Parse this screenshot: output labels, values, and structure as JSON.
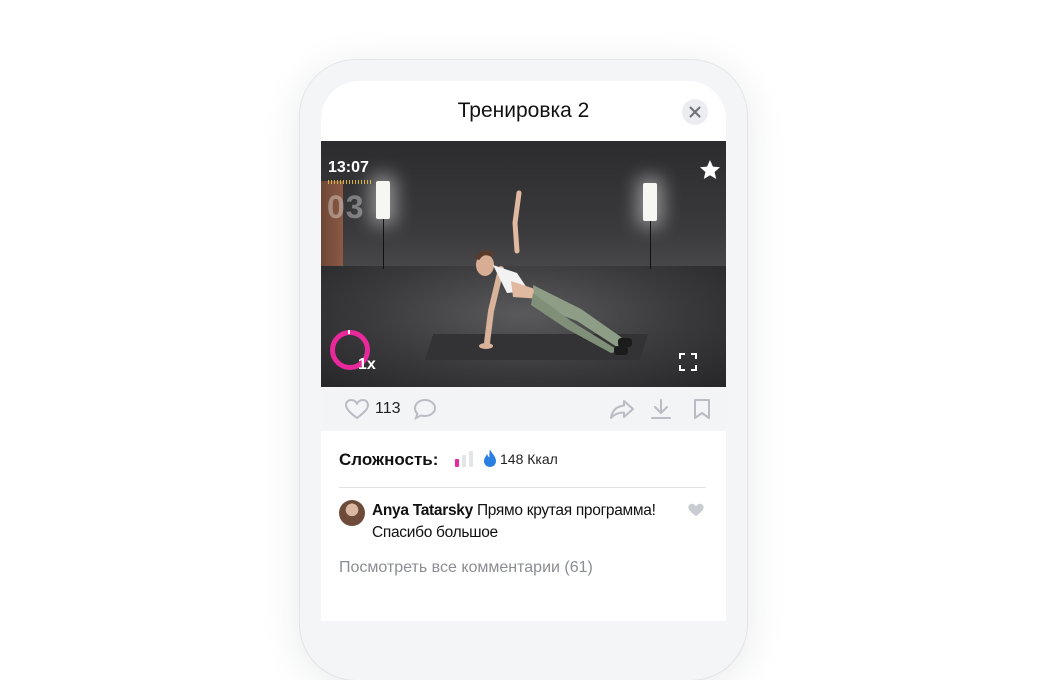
{
  "header": {
    "title": "Тренировка 2"
  },
  "video": {
    "time": "13:07",
    "counter": "03",
    "speed": "1x"
  },
  "actions": {
    "like_count": "113"
  },
  "info": {
    "difficulty_label": "Сложность:",
    "difficulty_level": "1 of 3",
    "calories": "148 Ккал"
  },
  "comment": {
    "author": "Anya Tatarsky",
    "text": " Прямо крутая программа! Спасибо большое"
  },
  "view_all": "Посмотреть все комментарии (61)",
  "colors": {
    "accent_pink": "#e8289b",
    "difficulty_inactive": "#e4e5e8",
    "calorie_blue": "#2a7fe0",
    "icon_grey": "#b9bcc2"
  }
}
